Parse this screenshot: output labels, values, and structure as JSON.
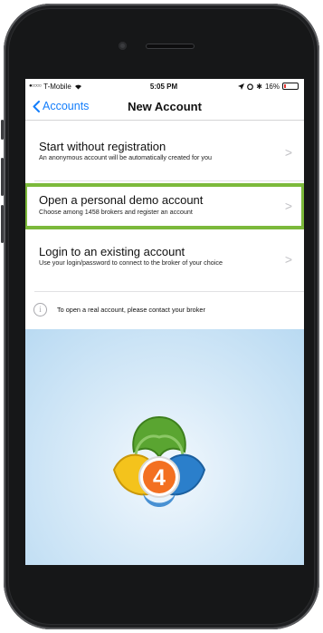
{
  "status_bar": {
    "carrier": "T-Mobile",
    "time": "5:05 PM",
    "battery": "16%",
    "battery_level": 0.16
  },
  "nav": {
    "back_label": "Accounts",
    "title": "New Account"
  },
  "options": [
    {
      "title": "Start without registration",
      "subtitle": "An anonymous account will be automatically created for you"
    },
    {
      "title": "Open a personal demo account",
      "subtitle": "Choose among 1458 brokers and register an account",
      "highlighted": true
    },
    {
      "title": "Login to an existing account",
      "subtitle": "Use your login/password to connect to the broker of your choice"
    }
  ],
  "info": {
    "icon": "info-icon",
    "text": "To open a real account, please contact your broker"
  },
  "logo": {
    "label": "4",
    "colors": {
      "green": "#5aa531",
      "yellow": "#f4c31c",
      "blue": "#2b7fcb",
      "orange": "#f37021"
    }
  },
  "accent_color": "#147efb",
  "highlight_color": "#7cb93b"
}
